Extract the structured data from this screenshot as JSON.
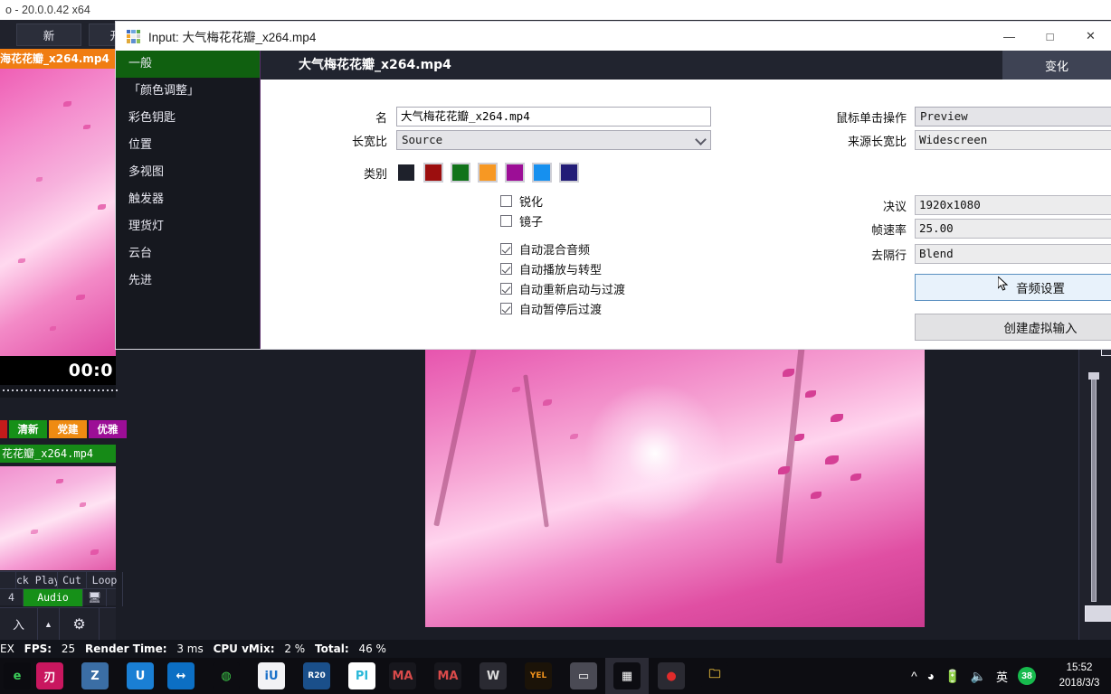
{
  "app": {
    "window_title": "o - 20.0.0.42 x64",
    "toolbar_buttons": [
      "新",
      "开放"
    ],
    "orange_input_label": "海花花瓣_x264.mp4",
    "timecode": "00:0",
    "tags": [
      "清新",
      "党建",
      "优雅"
    ],
    "green_file_label": "花花瓣_x264.mp4",
    "control_row_1": [
      "ck Play",
      "Cut",
      "Loop"
    ],
    "control_row_2": [
      "4",
      "Audio"
    ],
    "statusbar": {
      "ex": "EX",
      "fps_label": "FPS:",
      "fps_value": "25",
      "render_label": "Render Time:",
      "render_value": "3 ms",
      "cpu_label": "CPU vMix:",
      "cpu_value": "2 %",
      "total_label": "Total:",
      "total_value": "46 %"
    }
  },
  "dialog": {
    "title": "Input: 大气梅花花瓣_x264.mp4",
    "logo_colors": [
      "#3e6ec4",
      "#6fa6e0",
      "#57a84a",
      "#f0a62c",
      "#f0f0f0",
      "#cfcfcf",
      "#e0a93a",
      "#5e8fd0",
      "#8fbf5a"
    ],
    "window_buttons": [
      "minimize",
      "maximize",
      "close"
    ],
    "header_title": "大气梅花花瓣_x264.mp4",
    "tab_label": "变化",
    "sidebar": {
      "items": [
        {
          "label": "一般",
          "active": true
        },
        {
          "label": "「颜色调整」",
          "active": false
        },
        {
          "label": "彩色钥匙",
          "active": false
        },
        {
          "label": "位置",
          "active": false
        },
        {
          "label": "多视图",
          "active": false
        },
        {
          "label": "触发器",
          "active": false
        },
        {
          "label": "理货灯",
          "active": false
        },
        {
          "label": "云台",
          "active": false
        },
        {
          "label": "先进",
          "active": false
        }
      ]
    },
    "fields_left": {
      "name_label": "名",
      "name_value": "大气梅花花瓣_x264.mp4",
      "aspect_label": "长宽比",
      "aspect_value": "Source",
      "category_label": "类别",
      "category_colors": [
        "#1e212b",
        "#9c0e0e",
        "#11731a",
        "#f79823",
        "#9c0e96",
        "#1690ef",
        "#231d77"
      ],
      "category_selected_index": 0
    },
    "checkboxes": [
      {
        "label": "锐化",
        "checked": false
      },
      {
        "label": "镜子",
        "checked": false
      },
      {
        "label": "自动混合音频",
        "checked": true
      },
      {
        "label": "自动播放与转型",
        "checked": true
      },
      {
        "label": "自动重新启动与过渡",
        "checked": true
      },
      {
        "label": "自动暂停后过渡",
        "checked": true
      }
    ],
    "fields_right": {
      "click_action_label": "鼠标单击操作",
      "click_action_value": "Preview",
      "source_aspect_label": "来源长宽比",
      "source_aspect_value": "Widescreen",
      "resolution_label": "决议",
      "resolution_value": "1920x1080",
      "framerate_label": "帧速率",
      "framerate_value": "25.00",
      "deinterlace_label": "去隔行",
      "deinterlace_value": "Blend"
    },
    "buttons": {
      "audio_settings": "音频设置",
      "create_virtual_input": "创建虚拟输入"
    }
  },
  "taskbar": {
    "icons": [
      {
        "name": "edge-icon",
        "glyph": "e",
        "bg": "#0b0b10",
        "fg": "#3ccf5a"
      },
      {
        "name": "kingsoft-icon",
        "glyph": "刃",
        "bg": "#c9175f",
        "fg": "#ffffff"
      },
      {
        "name": "zotero-icon",
        "glyph": "Z",
        "bg": "#3b6ea5",
        "fg": "#ffffff"
      },
      {
        "name": "uc-icon",
        "glyph": "U",
        "bg": "#1a7fd4",
        "fg": "#ffffff"
      },
      {
        "name": "teamviewer-icon",
        "glyph": "↔",
        "bg": "#0c6fc4",
        "fg": "#ffffff"
      },
      {
        "name": "wechat-icon",
        "glyph": "◍",
        "bg": "#0d0d12",
        "fg": "#3ecb4a"
      },
      {
        "name": "iu-icon",
        "glyph": "iU",
        "bg": "#f2f2f5",
        "fg": "#1a70c8"
      },
      {
        "name": "cinema4d-icon",
        "glyph": "R20",
        "bg": "#1a4f8a",
        "fg": "#ffffff"
      },
      {
        "name": "pi-icon",
        "glyph": "PI",
        "bg": "#ffffff",
        "fg": "#2bb8d8"
      },
      {
        "name": "maya-icon",
        "glyph": "MA",
        "bg": "#17171d",
        "fg": "#d94a4a"
      },
      {
        "name": "maya3d-icon",
        "glyph": "MA",
        "bg": "#17171d",
        "fg": "#d94a4a"
      },
      {
        "name": "wysiwyg-icon",
        "glyph": "W",
        "bg": "#2a2a32",
        "fg": "#dcdcdc"
      },
      {
        "name": "yel-icon",
        "glyph": "YEL",
        "bg": "#1b1308",
        "fg": "#f0921c"
      },
      {
        "name": "cast-icon",
        "glyph": "▭",
        "bg": "#4a4a54",
        "fg": "#ffffff"
      },
      {
        "name": "vmix-icon",
        "glyph": "▦",
        "bg": "#0d0d12",
        "fg": "#ffffff"
      },
      {
        "name": "record-icon",
        "glyph": "●",
        "bg": "#2a2a32",
        "fg": "#e02b2b"
      },
      {
        "name": "explorer-icon",
        "glyph": "🗀",
        "bg": "#0d0d12",
        "fg": "#f0c23c"
      }
    ],
    "tray": {
      "chevron": "^",
      "wifi": "wifi-icon",
      "battery": "battery-icon",
      "volume": "volume-icon",
      "ime": "英",
      "battery_percent": "38",
      "time": "15:52",
      "date": "2018/3/3"
    }
  }
}
